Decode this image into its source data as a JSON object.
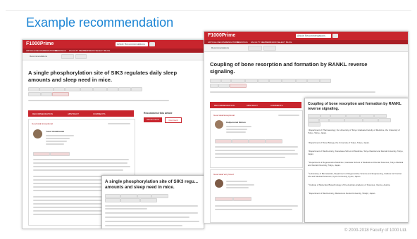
{
  "slide": {
    "title": "Example recommendation",
    "copyright": "© 2000-2018 Faculty of 1000 Ltd."
  },
  "left": {
    "logo": "F1000Prime",
    "search_placeholder": "Article Recommendations",
    "nav": [
      "ARTICLE RECOMMENDATIONS",
      "RANKINGS",
      "FACULTY MEMBERS",
      "F1000 SELECT",
      "BLOG"
    ],
    "crumb": "Recommendations",
    "title_l1": "A single phosphorylation site of SIK3 regulates daily sleep",
    "title_l2": "amounts and sleep need in mice.",
    "tabs": [
      "RECOMMENDATION",
      "ABSTRACT",
      "COMMENTS"
    ],
    "rating": "Good ●●● Exceptional",
    "recommend_heading": "Recommend this article",
    "recommend_btn": "Recommend",
    "comment_btn": "Comment",
    "reviewer_name": "Yusuf Abdelhamid",
    "popup_title_l1": "A single phosphorylation site of SIK3 regu...",
    "popup_title_l2": "amounts and sleep need in mice."
  },
  "right": {
    "logo": "F1000Prime",
    "search_placeholder": "Article Recommendations",
    "nav": [
      "ARTICLE RECOMMENDATIONS",
      "RANKINGS",
      "FACULTY MEMBERS",
      "F1000 SELECT",
      "BLOG"
    ],
    "crumb": "Recommendations",
    "title_l1": "Coupling of bone resorption and formation by RANKL reverse",
    "title_l2": "signaling.",
    "tabs": [
      "RECOMMENDATION",
      "ABSTRACT",
      "COMMENTS"
    ],
    "rating": "Good ●●● Exceptional",
    "reviewer_name": "Kaliperumal Mohan",
    "rating2": "Good ●●● Very Good",
    "popup_title_l1": "Coupling of bone resorption and formation by RANKL",
    "popup_title_l2": "reverse signaling.",
    "affiliations": [
      "¹ Department of Pharmacology, the University of Tokyo Graduate Faculty of Medicine, the University of Tokyo, Tokyo, Japan.",
      "² Department of Bone Biology, the University of Tokyo, Tokyo, Japan.",
      "³ Department of Biochemistry, Kanazawa School of Medicine, Tokyo Medical and Dental University, Tokyo, Japan.",
      "⁴ Department of Regenerative Medicine, Graduate School of Medical and Dental Sciences, Tokyo Medical and Dental University, Tokyo, Japan.",
      "⁵ Laboratory of Biomaterials, Department of Regenerative Science and Engineering, Institute for Frontier Life and Medical Sciences, Kyoto University, Kyoto, Japan.",
      "⁶ Institute of Molecular Biotechnology of the Austrian Academy of Sciences, Vienna, Austria.",
      "⁷ Department of Biochemistry, Matsumoto Dental University, Shiojiri, Japan."
    ]
  }
}
